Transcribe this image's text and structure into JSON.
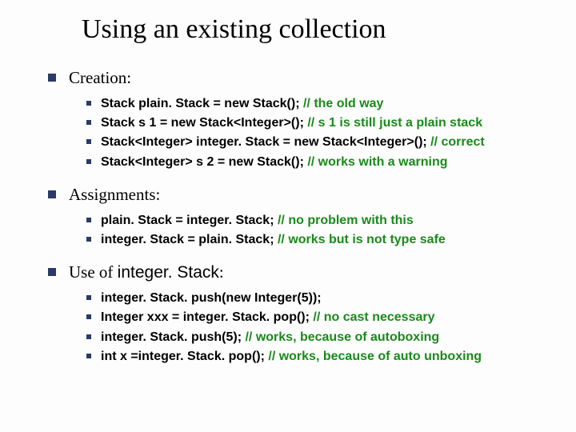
{
  "title": "Using an existing collection",
  "sections": [
    {
      "label": "Creation:",
      "items": [
        {
          "code": "Stack plain. Stack = new Stack(); ",
          "comment": "// the old way"
        },
        {
          "code": "Stack s 1 = new Stack<Integer>(); ",
          "comment": "// s 1 is still just a plain stack"
        },
        {
          "code": "Stack<Integer> integer. Stack = new Stack<Integer>(); ",
          "comment": "// correct"
        },
        {
          "code": "Stack<Integer> s 2 = new Stack(); ",
          "comment": "// works with a warning"
        }
      ]
    },
    {
      "label": "Assignments:",
      "items": [
        {
          "code": "plain. Stack = integer. Stack; ",
          "comment": "// no problem with this"
        },
        {
          "code": "integer. Stack = plain. Stack; ",
          "comment": "// works but is not type safe"
        }
      ]
    },
    {
      "label_prefix": "Use of ",
      "label_code": "integer. Stack",
      "label_suffix": ":",
      "items": [
        {
          "code": "integer. Stack. push(new Integer(5));",
          "comment": ""
        },
        {
          "code": "Integer xxx = integer. Stack. pop(); ",
          "comment": "// no cast necessary"
        },
        {
          "code": "integer. Stack. push(5); ",
          "comment": "// works, because of autoboxing"
        },
        {
          "code": "int x =integer. Stack. pop(); ",
          "comment": "// works, because of auto unboxing"
        }
      ]
    }
  ]
}
